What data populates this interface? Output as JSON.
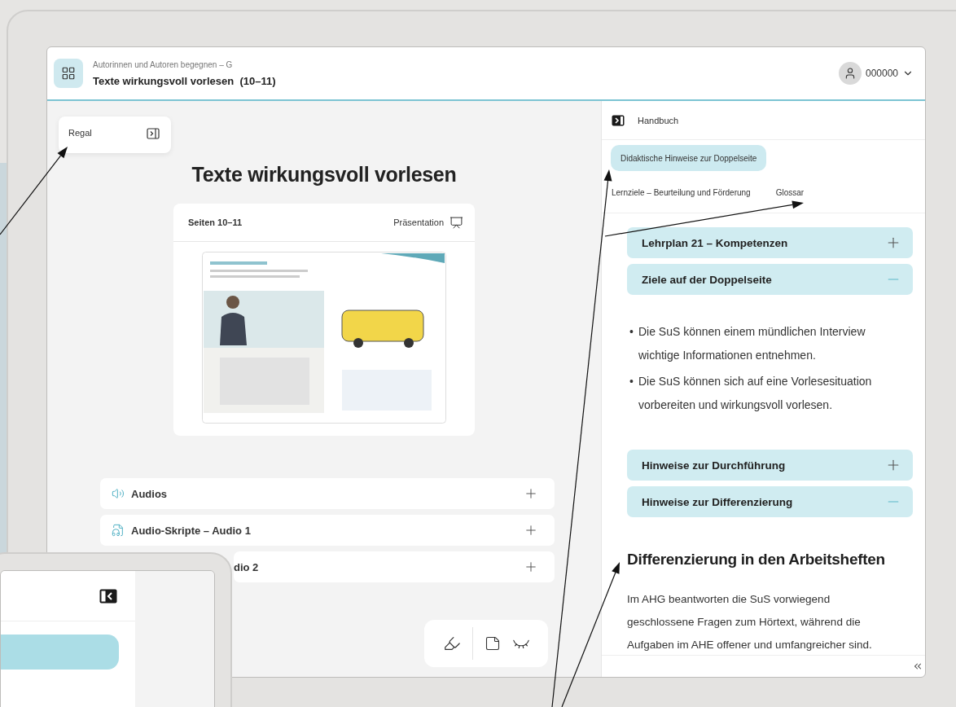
{
  "header": {
    "subtitle": "Autorinnen und Autoren begegnen – G",
    "title": "Texte wirkungsvoll vorlesen  (10–11)",
    "user": "000000"
  },
  "shelf": {
    "label": "Regal"
  },
  "page_title": "Texte wirkungsvoll vorlesen",
  "spread_card": {
    "title": "Seiten 10–11",
    "action": "Präsentation",
    "kind": "picture"
  },
  "materials": [
    {
      "label": "Audios",
      "kind": "audio",
      "expanded": false
    },
    {
      "label": "Audio-Skripte – Audio 1",
      "kind": "script",
      "expanded": false
    },
    {
      "label": "dio 2",
      "kind": "covered",
      "expanded": false
    }
  ],
  "handbook": {
    "title": "Handbuch",
    "tabs": [
      {
        "label": "Didaktische Hinweise zur Doppelseite",
        "selected": true
      },
      {
        "label": "Lernziele – Beurteilung und Förderung",
        "selected": false
      },
      {
        "label": "Glossar",
        "selected": false
      }
    ],
    "sections": [
      {
        "title": "Lehrplan 21 – Kompetenzen",
        "expanded": false
      },
      {
        "title": "Ziele auf der Doppelseite",
        "expanded": true,
        "bullets": [
          {
            "marker": "•",
            "text": "Die SuS können einem mündlichen Interview wichtige Informationen entnehmen."
          },
          {
            "marker": "•",
            "text": "Die SuS können sich auf eine Vorlesesituation vorbereiten und wirkungsvoll vorlesen."
          }
        ]
      },
      {
        "title": "Hinweise zur Durchführung",
        "expanded": false
      },
      {
        "title": "Hinweise zur Differenzierung",
        "expanded": true,
        "heading": "Differenzierung in den Arbeitsheften",
        "paragraph": "Im AHG beantworten die SuS vorwiegend geschlossene Fragen zum Hörtext, während die Aufgaben im AHE offener und umfangreicher sind."
      }
    ]
  }
}
